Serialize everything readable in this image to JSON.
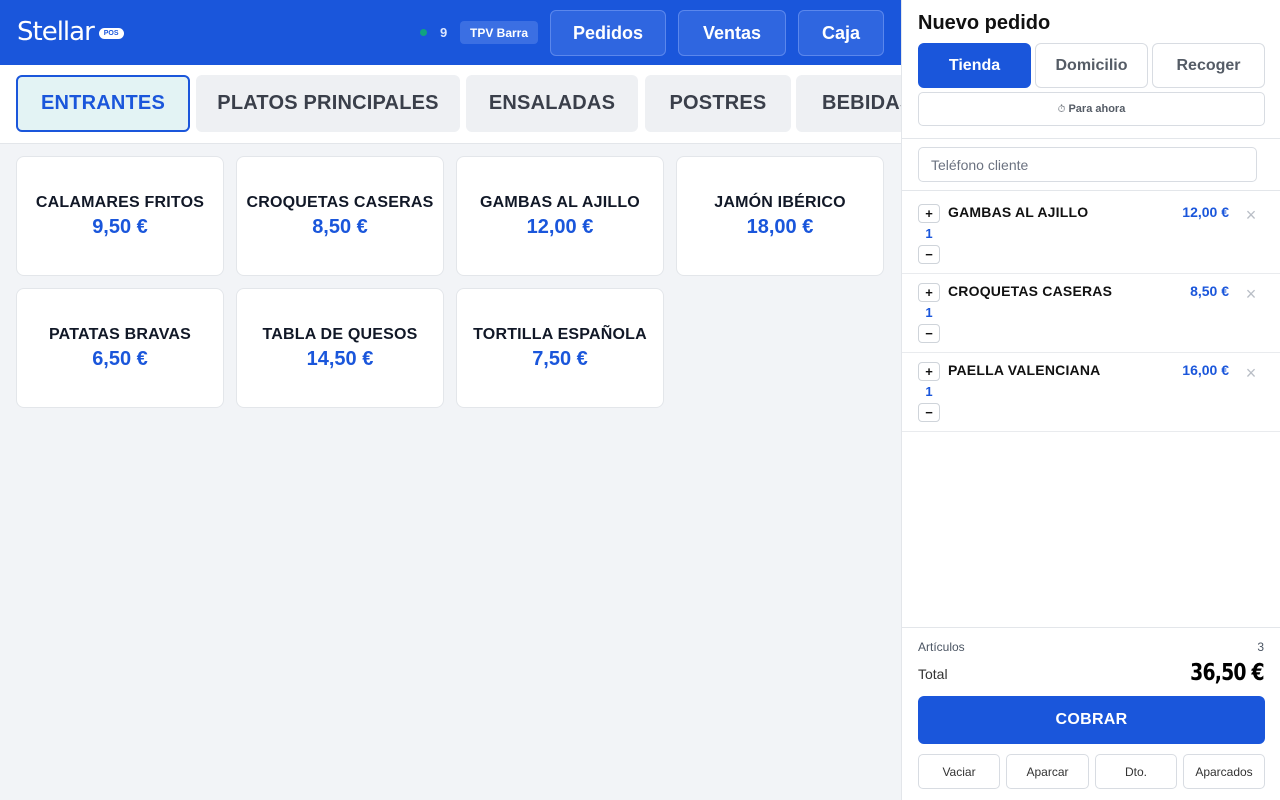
{
  "header": {
    "logo_text": "Stellar",
    "logo_badge": "POS",
    "status_color": "#10a37f",
    "order_count": "9",
    "terminal": "TPV Barra",
    "nav": [
      {
        "label": "Pedidos"
      },
      {
        "label": "Ventas"
      },
      {
        "label": "Caja"
      }
    ]
  },
  "categories": [
    {
      "label": "ENTRANTES",
      "active": true
    },
    {
      "label": "PLATOS PRINCIPALES",
      "active": false
    },
    {
      "label": "ENSALADAS",
      "active": false
    },
    {
      "label": "POSTRES",
      "active": false
    },
    {
      "label": "BEBIDAS",
      "active": false
    }
  ],
  "products": [
    {
      "name": "CALAMARES FRITOS",
      "price": "9,50 €"
    },
    {
      "name": "CROQUETAS CASERAS",
      "price": "8,50 €"
    },
    {
      "name": "GAMBAS AL AJILLO",
      "price": "12,00 €"
    },
    {
      "name": "JAMÓN IBÉRICO",
      "price": "18,00 €"
    },
    {
      "name": "PATATAS BRAVAS",
      "price": "6,50 €"
    },
    {
      "name": "TABLA DE QUESOS",
      "price": "14,50 €"
    },
    {
      "name": "TORTILLA ESPAÑOLA",
      "price": "7,50 €"
    }
  ],
  "order": {
    "title": "Nuevo pedido",
    "modes": [
      {
        "label": "Tienda",
        "active": true
      },
      {
        "label": "Domicilio",
        "active": false
      },
      {
        "label": "Recoger",
        "active": false
      }
    ],
    "schedule_icon": "⏱",
    "schedule_label": "Para ahora",
    "phone_placeholder": "Teléfono cliente",
    "phone_value": "",
    "items": [
      {
        "name": "GAMBAS AL AJILLO",
        "qty": "1",
        "price": "12,00 €"
      },
      {
        "name": "CROQUETAS CASERAS",
        "qty": "1",
        "price": "8,50 €"
      },
      {
        "name": "PAELLA VALENCIANA",
        "qty": "1",
        "price": "16,00 €"
      }
    ],
    "plus_label": "+",
    "minus_label": "−",
    "remove_label": "×",
    "articles_label": "Artículos",
    "articles_count": "3",
    "total_label": "Total",
    "total_value": "36,50 €",
    "pay_label": "COBRAR",
    "footer_buttons": [
      {
        "label": "Vaciar"
      },
      {
        "label": "Aparcar"
      },
      {
        "label": "Dto."
      },
      {
        "label": "Aparcados"
      }
    ]
  },
  "colors": {
    "primary": "#1a56db",
    "background": "#f2f4f7"
  }
}
